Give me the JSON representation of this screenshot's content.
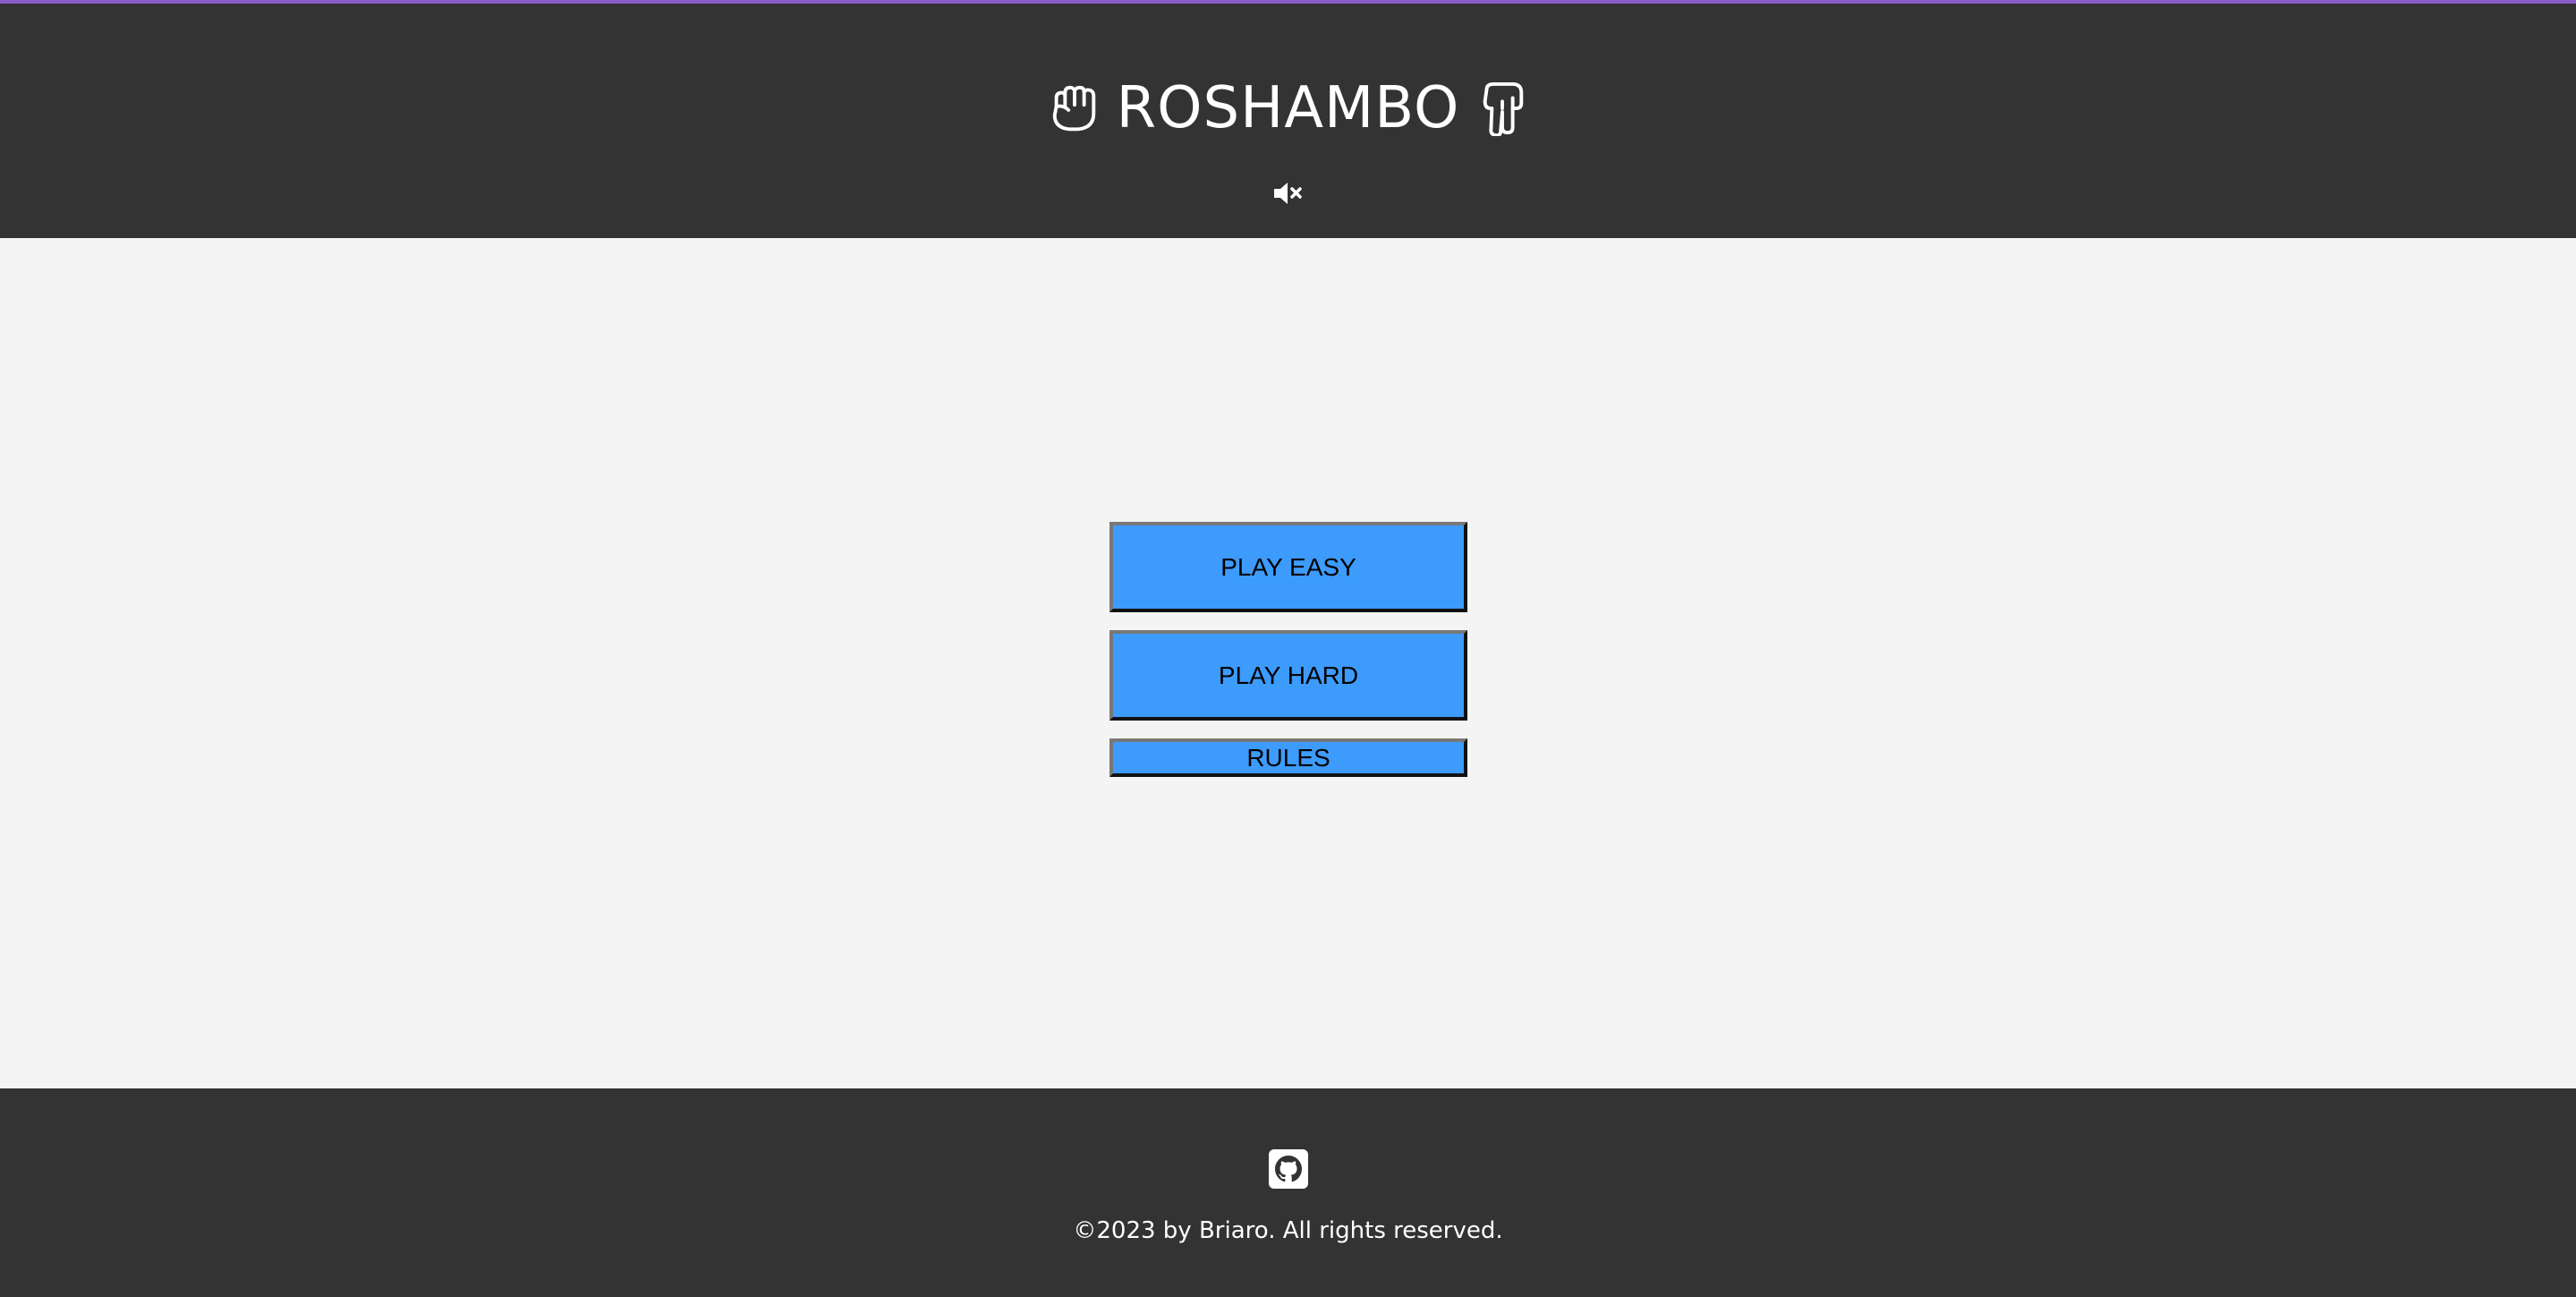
{
  "header": {
    "title": "ROSHAMBO",
    "left_icon": "rock-hand-icon",
    "right_icon": "scissors-hand-icon",
    "sound_icon": "volume-mute-icon"
  },
  "menu": {
    "play_easy_label": "PLAY EASY",
    "play_hard_label": "PLAY HARD",
    "rules_label": "RULES"
  },
  "footer": {
    "github_icon": "github-icon",
    "copyright": "©2023 by Briaro. All rights reserved."
  },
  "colors": {
    "header_bg": "#333333",
    "main_bg": "#f4f4f4",
    "button_bg": "#3d9bfc",
    "accent_bar": "#8a5cc7",
    "text_light": "#ffffff"
  }
}
